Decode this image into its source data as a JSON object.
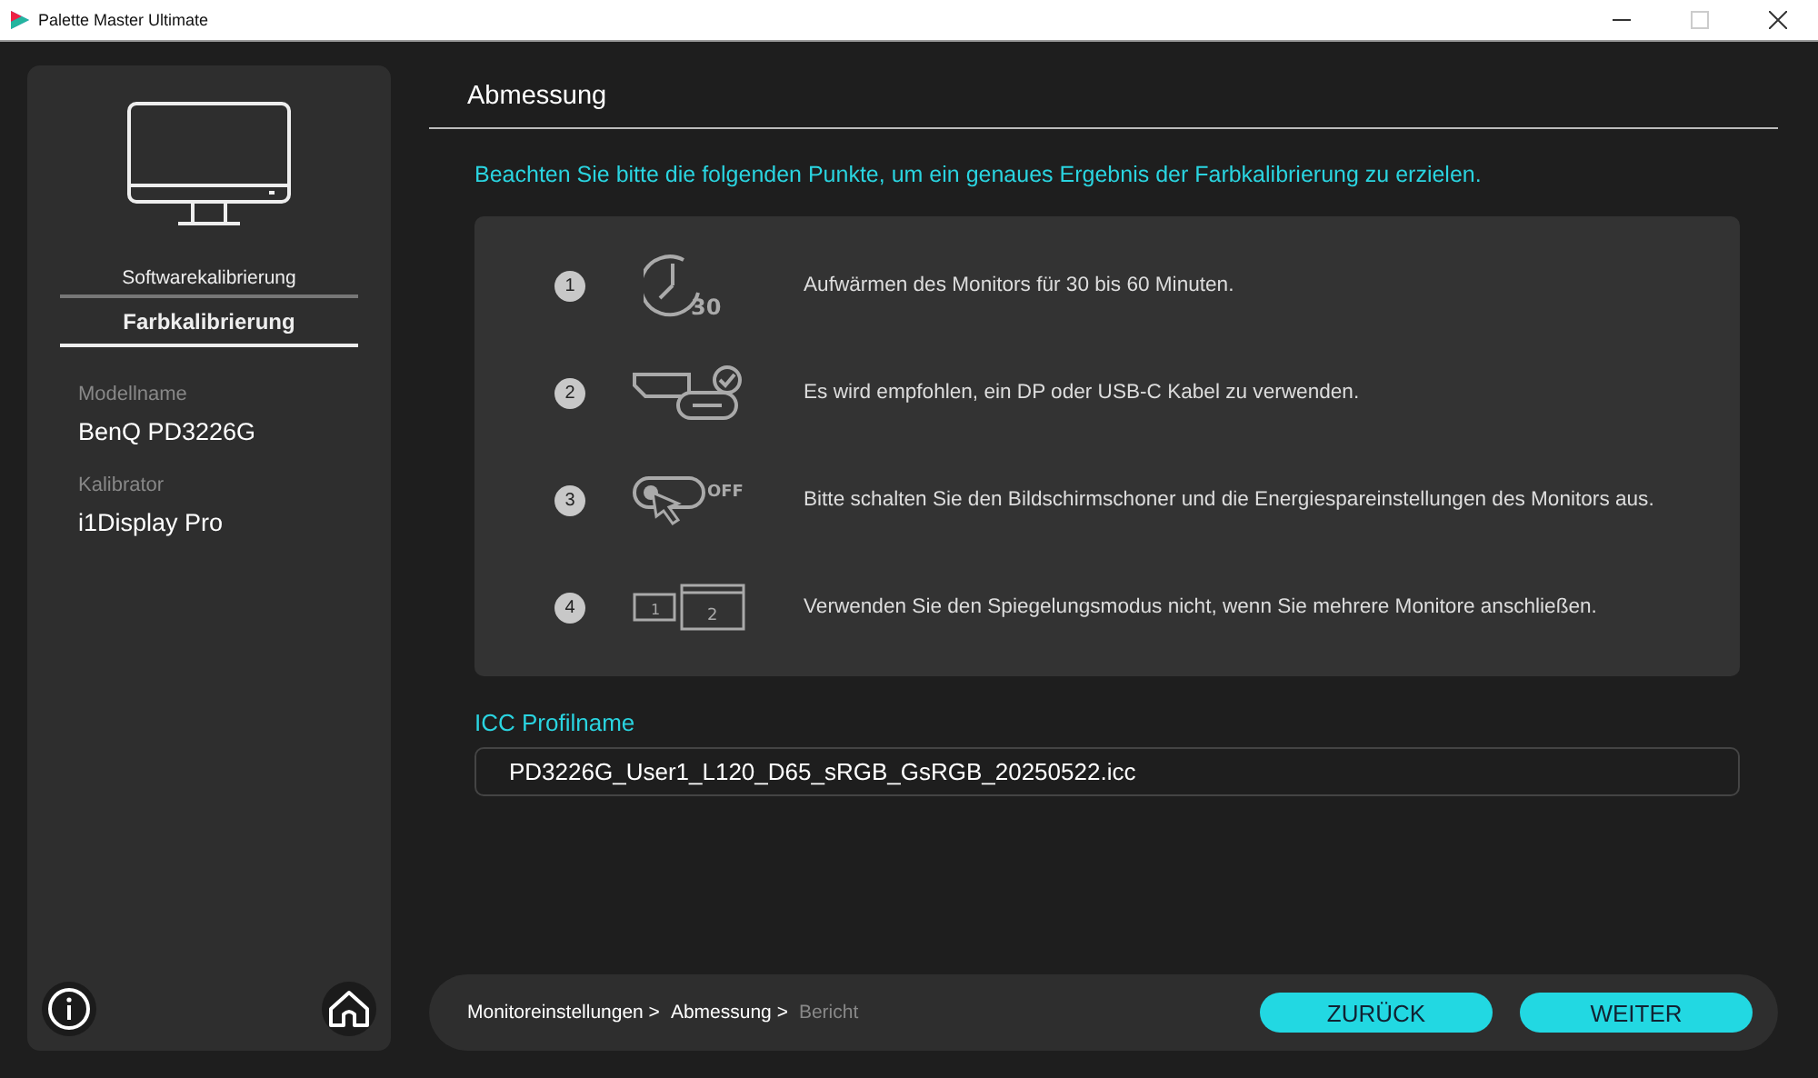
{
  "window": {
    "title": "Palette Master Ultimate",
    "maximize_disabled": true
  },
  "sidebar": {
    "tabs": [
      {
        "label": "Softwarekalibrierung",
        "selected": false
      },
      {
        "label": "Farbkalibrierung",
        "selected": true
      }
    ],
    "fields": [
      {
        "label": "Modellname",
        "value": "BenQ PD3226G"
      },
      {
        "label": "Kalibrator",
        "value": "i1Display Pro"
      }
    ]
  },
  "header": {
    "title": "Abmessung"
  },
  "intro": "Beachten Sie bitte die folgenden Punkte, um ein genaues Ergebnis der Farbkalibrierung zu erzielen.",
  "steps": [
    {
      "number": "1",
      "kind": "clock",
      "icon_text": "30",
      "text": "Aufwärmen des Monitors für 30 bis 60 Minuten."
    },
    {
      "number": "2",
      "kind": "cable",
      "text": "Es wird empfohlen, ein DP oder USB-C Kabel zu verwenden."
    },
    {
      "number": "3",
      "kind": "switch",
      "icon_text": "OFF",
      "text": "Bitte schalten Sie den Bildschirmschoner und die Energiespareinstellungen des Monitors aus."
    },
    {
      "number": "4",
      "kind": "screens",
      "icon_text": "1",
      "icon_text_2": "2",
      "text": "Verwenden Sie den Spiegelungsmodus nicht, wenn Sie mehrere Monitore anschließen."
    }
  ],
  "icc": {
    "label": "ICC Profilname",
    "value": "PD3226G_User1_L120_D65_sRGB_GsRGB_20250522.icc"
  },
  "breadcrumb": [
    {
      "label": "Monitoreinstellungen >",
      "enabled": true
    },
    {
      "label": "Abmessung >",
      "enabled": true
    },
    {
      "label": "Bericht",
      "enabled": false
    }
  ],
  "buttons": [
    {
      "label": "ZURÜCK"
    },
    {
      "label": "WEITER"
    }
  ]
}
